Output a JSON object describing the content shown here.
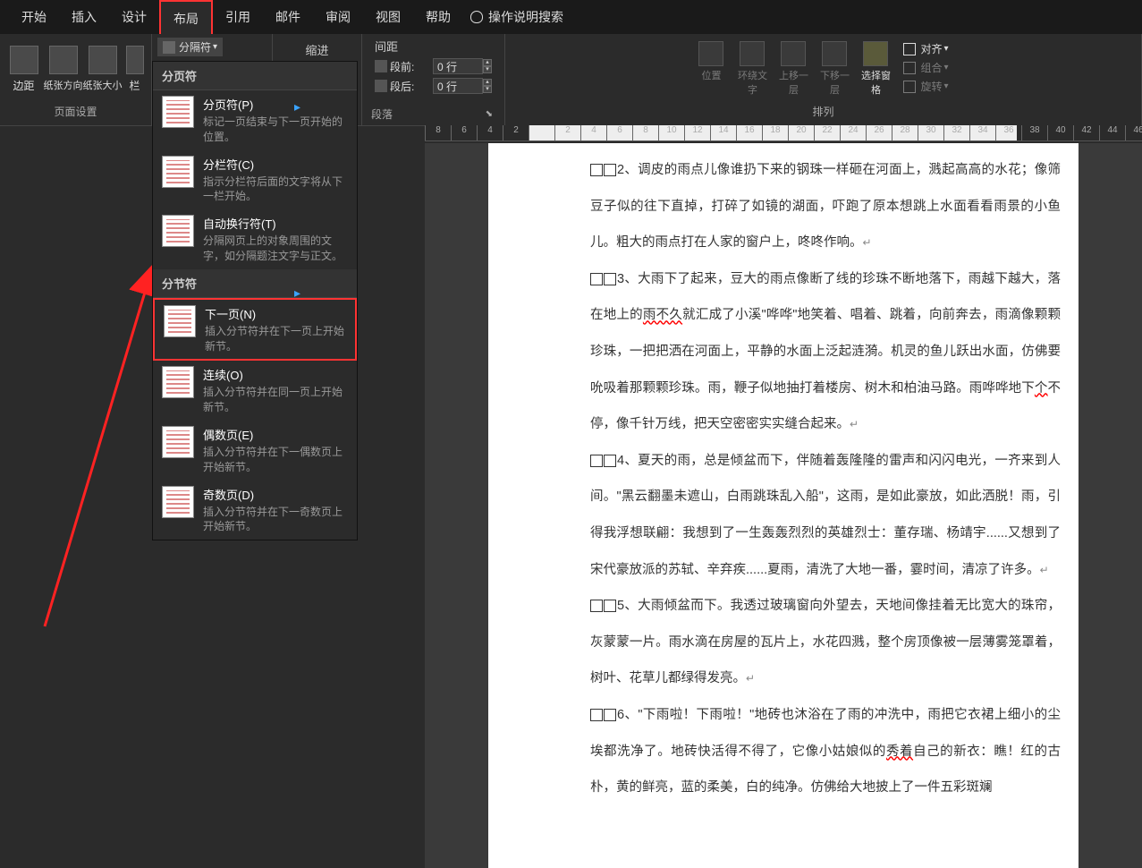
{
  "tabs": [
    "开始",
    "插入",
    "设计",
    "布局",
    "引用",
    "邮件",
    "审阅",
    "视图",
    "帮助"
  ],
  "active_tab_index": 3,
  "tell_me": "操作说明搜索",
  "ribbon": {
    "page_setup": {
      "margin": "边距",
      "orientation": "纸张方向",
      "size": "纸张大小",
      "columns": "栏",
      "breaks": "分隔符",
      "group_label": "页面设置"
    },
    "indent": {
      "label": "缩进"
    },
    "spacing": {
      "label": "间距",
      "before_label": "段前:",
      "before_value": "0 行",
      "after_label": "段后:",
      "after_value": "0 行"
    },
    "paragraph_group": "段落",
    "arrange": {
      "position": "位置",
      "wrap": "环绕文字",
      "forward": "上移一层",
      "backward": "下移一层",
      "selection_pane": "选择窗格",
      "align": "对齐",
      "group": "组合",
      "rotate": "旋转",
      "group_label": "排列"
    }
  },
  "dropdown": {
    "section1": "分页符",
    "section2": "分节符",
    "items": [
      {
        "title": "分页符(P)",
        "desc": "标记一页结束与下一页开始的位置。"
      },
      {
        "title": "分栏符(C)",
        "desc": "指示分栏符后面的文字将从下一栏开始。"
      },
      {
        "title": "自动换行符(T)",
        "desc": "分隔网页上的对象周围的文字，如分隔题注文字与正文。"
      },
      {
        "title": "下一页(N)",
        "desc": "插入分节符并在下一页上开始新节。"
      },
      {
        "title": "连续(O)",
        "desc": "插入分节符并在同一页上开始新节。"
      },
      {
        "title": "偶数页(E)",
        "desc": "插入分节符并在下一偶数页上开始新节。"
      },
      {
        "title": "奇数页(D)",
        "desc": "插入分节符并在下一奇数页上开始新节。"
      }
    ]
  },
  "ruler_ticks": [
    "8",
    "6",
    "4",
    "2",
    "",
    "2",
    "4",
    "6",
    "8",
    "10",
    "12",
    "14",
    "16",
    "18",
    "20",
    "22",
    "24",
    "26",
    "28",
    "30",
    "32",
    "34",
    "36",
    "38",
    "40",
    "42",
    "44",
    "46"
  ],
  "document": {
    "paragraphs": [
      {
        "num": "2、",
        "text": "调皮的雨点儿像谁扔下来的钢珠一样砸在河面上，溅起高高的水花；像筛豆子似的往下直掉，打碎了如镜的湖面，吓跑了原本想跳上水面看看雨景的小鱼儿。粗大的雨点打在人家的窗户上，咚咚作响。"
      },
      {
        "num": "3、",
        "text_a": "大雨下了起来，豆大的雨点像断了线的珍珠不断地落下，雨越下越大，落在地上的",
        "wavy": "雨不久",
        "text_b": "就汇成了小溪\"哗哗\"地笑着、唱着、跳着，向前奔去，雨滴像颗颗珍珠，一把把洒在河面上，平静的水面上泛起涟漪。机灵的鱼儿跃出水面，仿佛要吮吸着那颗颗珍珠。雨，鞭子似地抽打着楼房、树木和柏油马路。雨哗哗地下",
        "wavy2": "个",
        "text_c": "不停，像千针万线，把天空密密实实缝合起来。"
      },
      {
        "num": "4、",
        "text": "夏天的雨，总是倾盆而下，伴随着轰隆隆的雷声和闪闪电光，一齐来到人间。\"黑云翻墨未遮山，白雨跳珠乱入船\"，这雨，是如此豪放，如此洒脱！雨，引得我浮想联翩：我想到了一生轰轰烈烈的英雄烈士：董存瑞、杨靖宇......又想到了宋代豪放派的苏轼、辛弃疾......夏雨，清洗了大地一番，霎时间，清凉了许多。"
      },
      {
        "num": "5、",
        "text": "大雨倾盆而下。我透过玻璃窗向外望去，天地间像挂着无比宽大的珠帘，灰蒙蒙一片。雨水滴在房屋的瓦片上，水花四溅，整个房顶像被一层薄雾笼罩着，树叶、花草儿都绿得发亮。"
      },
      {
        "num": "6、",
        "text_a": "\"下雨啦！下雨啦！\"地砖也沐浴在了雨的冲洗中，雨把它衣裙上细小的尘埃都洗净了。地砖快活得不得了，它像小姑娘似的",
        "wavy": "秀着",
        "text_b": "自己的新衣：瞧！红的古朴，黄的鲜亮，蓝的柔美，白的纯净。仿佛给大地披上了一件五彩斑斓"
      }
    ]
  }
}
